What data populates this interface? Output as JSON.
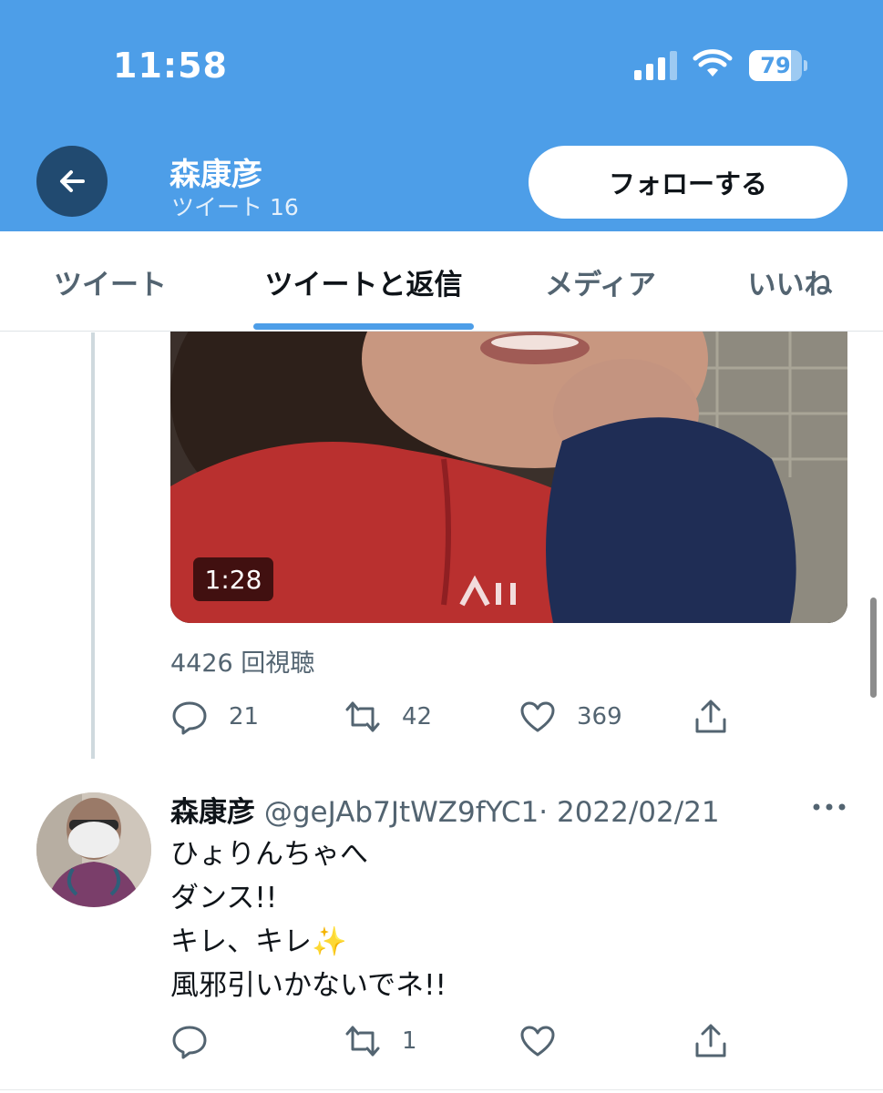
{
  "status_bar": {
    "time": "11:58",
    "battery": "79",
    "battery_level": 0.79
  },
  "header": {
    "back_icon": "arrow-left-icon",
    "name": "森康彦",
    "tweet_count": "ツイート 16",
    "follow_label": "フォローする"
  },
  "tabs": [
    {
      "label": "ツイート",
      "active": false
    },
    {
      "label": "ツイートと返信",
      "active": true
    },
    {
      "label": "メディア",
      "active": false
    },
    {
      "label": "いいね",
      "active": false
    }
  ],
  "tweet1": {
    "video_duration": "1:28",
    "views": "4426 回視聴",
    "replies": "21",
    "retweets": "42",
    "likes": "369"
  },
  "tweet2": {
    "name": "森康彦",
    "handle": "@geJAb7JtWZ9fYC1",
    "separator": "·",
    "date": "2022/02/21",
    "lines": [
      "ひょりんちゃへ",
      "ダンス!!",
      "キレ、キレ✨",
      "風邪引いかないでネ!!"
    ],
    "replies": "",
    "retweets": "1",
    "likes": ""
  },
  "colors": {
    "header_blue": "#4d9ee8",
    "back_button": "#214a70",
    "text_primary": "#0f1419",
    "text_secondary": "#536471"
  }
}
